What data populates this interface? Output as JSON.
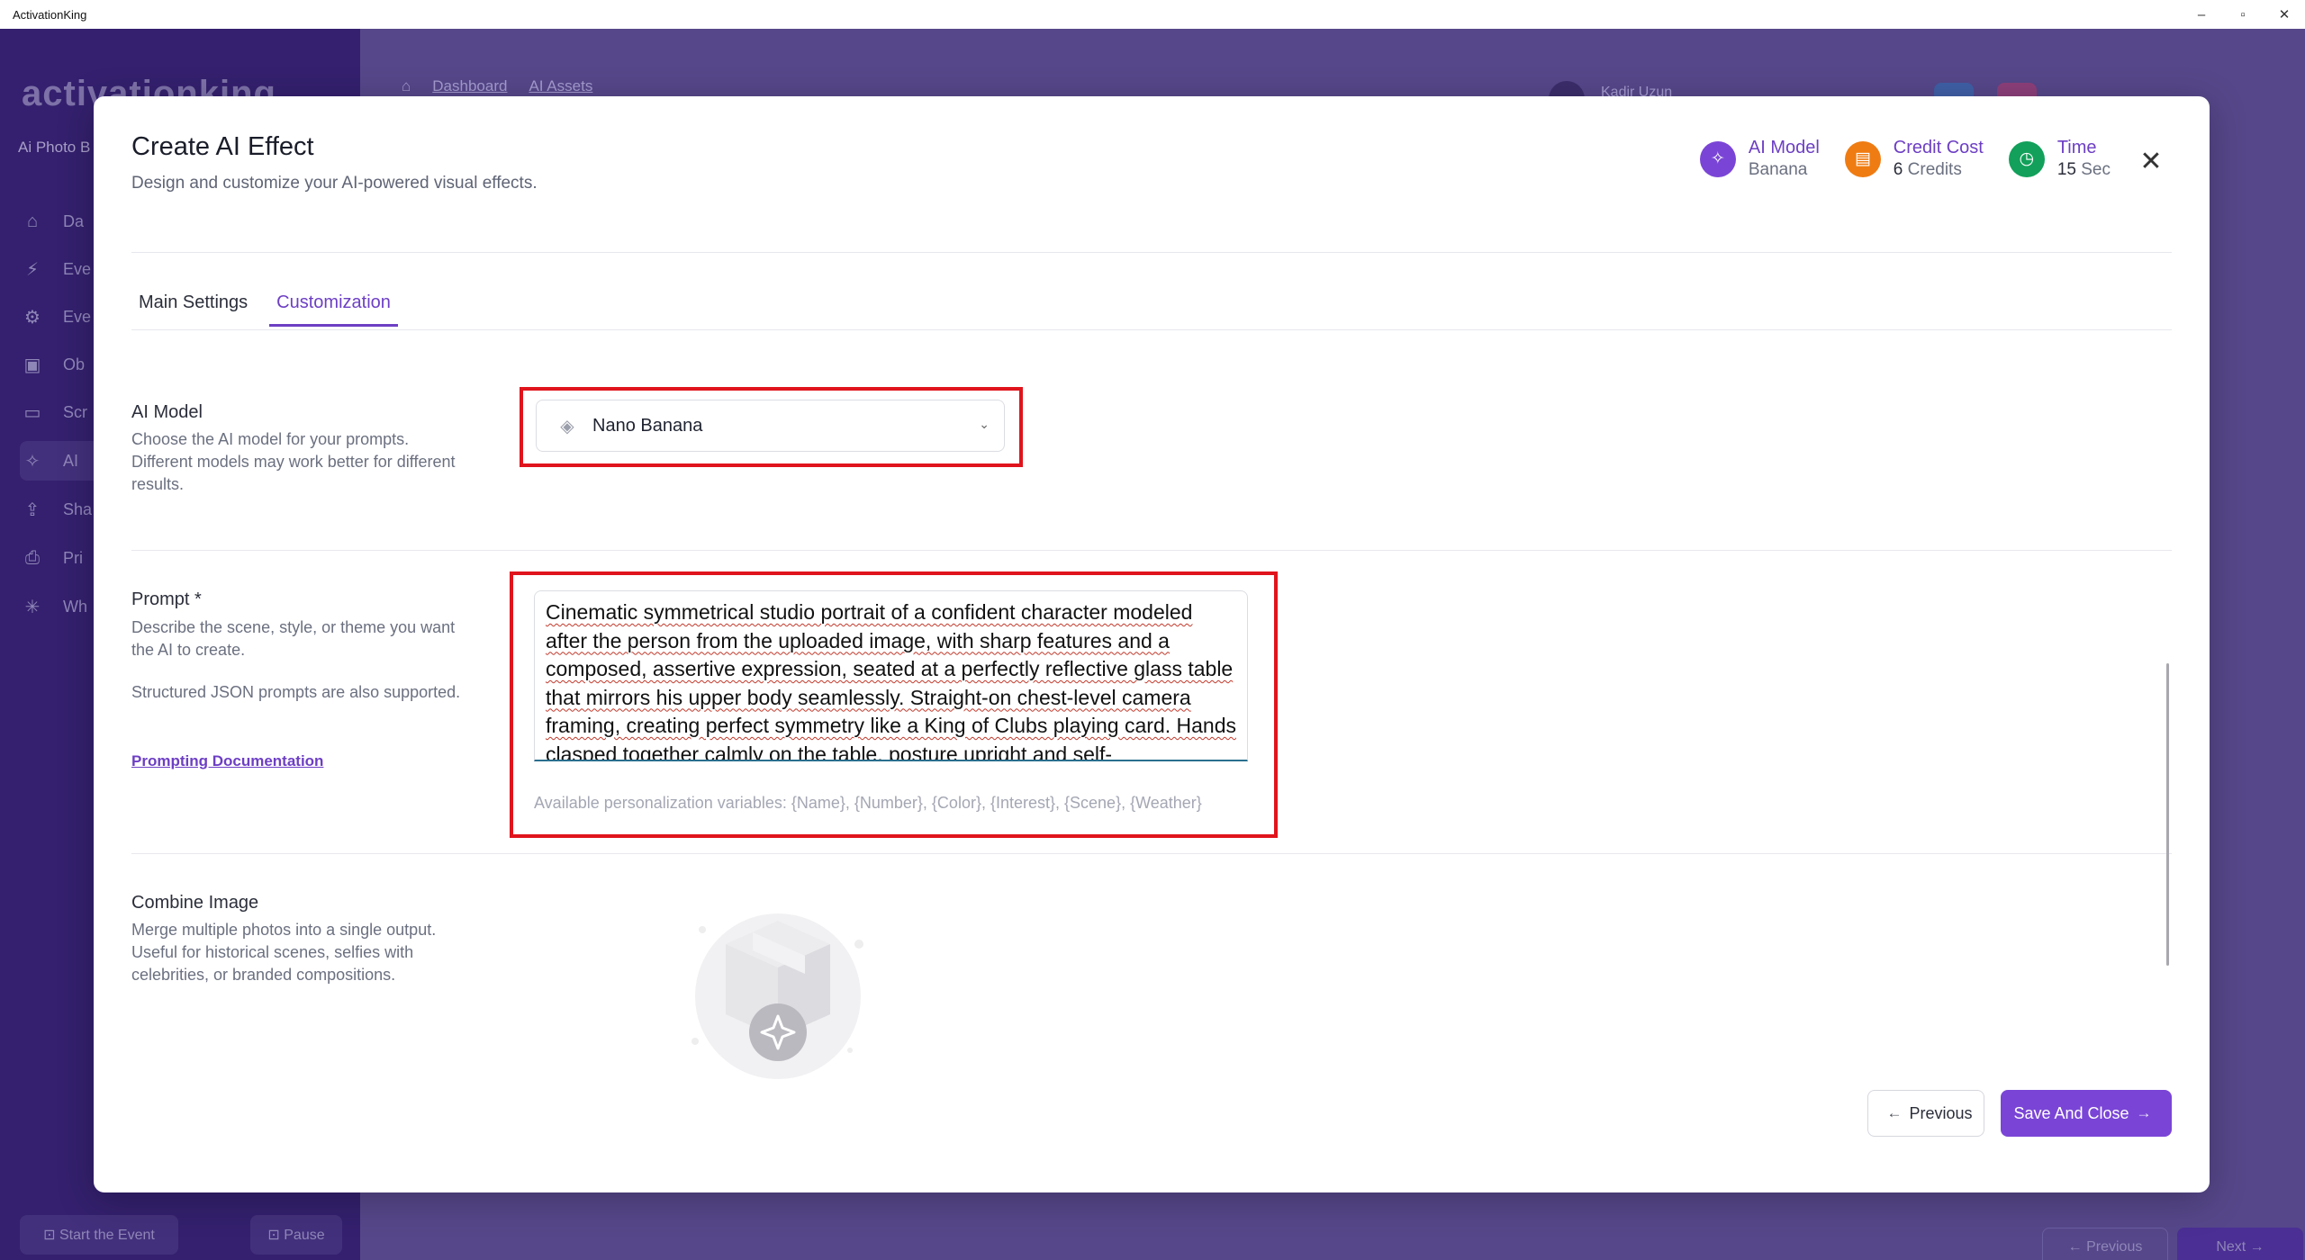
{
  "window": {
    "title": "ActivationKing",
    "controls": [
      "–",
      "▫",
      "✕"
    ]
  },
  "background": {
    "logo": "activationking",
    "section": "Ai Photo B",
    "nav": [
      {
        "icon": "⌂",
        "label": "Da"
      },
      {
        "icon": "⚡",
        "label": "Eve"
      },
      {
        "icon": "⚙",
        "label": "Eve"
      },
      {
        "icon": "▣",
        "label": "Ob"
      },
      {
        "icon": "▭",
        "label": "Scr"
      },
      {
        "icon": "✧",
        "label": "AI"
      },
      {
        "icon": "⇪",
        "label": "Sha"
      },
      {
        "icon": "⎙",
        "label": "Pri"
      },
      {
        "icon": "✳",
        "label": "Wh"
      }
    ],
    "breadcrumbs": [
      "Dashboard",
      "AI Assets"
    ],
    "username": "Kadir Uzun",
    "start_label": "⊡ Start the Event",
    "pause_label": "⊡ Pause",
    "prev_label": "← Previous",
    "next_label": "Next →"
  },
  "modal": {
    "title": "Create AI Effect",
    "subtitle": "Design and customize your AI-powered visual effects.",
    "stats": [
      {
        "label": "AI Model",
        "value_bold": "",
        "value": "Banana",
        "color": "#7a45d6",
        "label_color": "#6d3fc4",
        "icon": "sparkles-icon",
        "glyph": "✧"
      },
      {
        "label": "Credit Cost",
        "value_bold": "6",
        "value": " Credits",
        "color": "#ef7c12",
        "label_color": "#6d3fc4",
        "icon": "coins-icon",
        "glyph": "▤"
      },
      {
        "label": "Time",
        "value_bold": "15",
        "value": " Sec",
        "color": "#12a05a",
        "label_color": "#6d3fc4",
        "icon": "clock-icon",
        "glyph": "◷"
      }
    ],
    "close_glyph": "✕",
    "tabs": [
      {
        "label": "Main Settings",
        "active": false
      },
      {
        "label": "Customization",
        "active": true
      }
    ],
    "ai_model": {
      "title": "AI Model",
      "description": "Choose the AI model for your prompts. Different models may work better for different results.",
      "selected": "Nano Banana"
    },
    "prompt": {
      "title": "Prompt *",
      "description": "Describe the scene, style, or theme you want the AI to create.",
      "note": "Structured JSON prompts are also supported.",
      "doc_link": "Prompting Documentation",
      "value": "Cinematic symmetrical studio portrait of a confident character modeled after the person from the uploaded image, with sharp features and a composed, assertive expression, seated at a perfectly reflective glass table that mirrors his upper body seamlessly. Straight-on chest-level camera framing, creating perfect symmetry like a King of Clubs playing card. Hands clasped together calmly on the table, posture upright and self-",
      "variables": "Available personalization variables: {Name}, {Number}, {Color}, {Interest}, {Scene}, {Weather}"
    },
    "combine_image": {
      "title": "Combine Image",
      "description": "Merge multiple photos into a single output. Useful for historical scenes, selfies with celebrities, or branded compositions."
    },
    "buttons": {
      "previous": "Previous",
      "save": "Save And Close"
    }
  }
}
